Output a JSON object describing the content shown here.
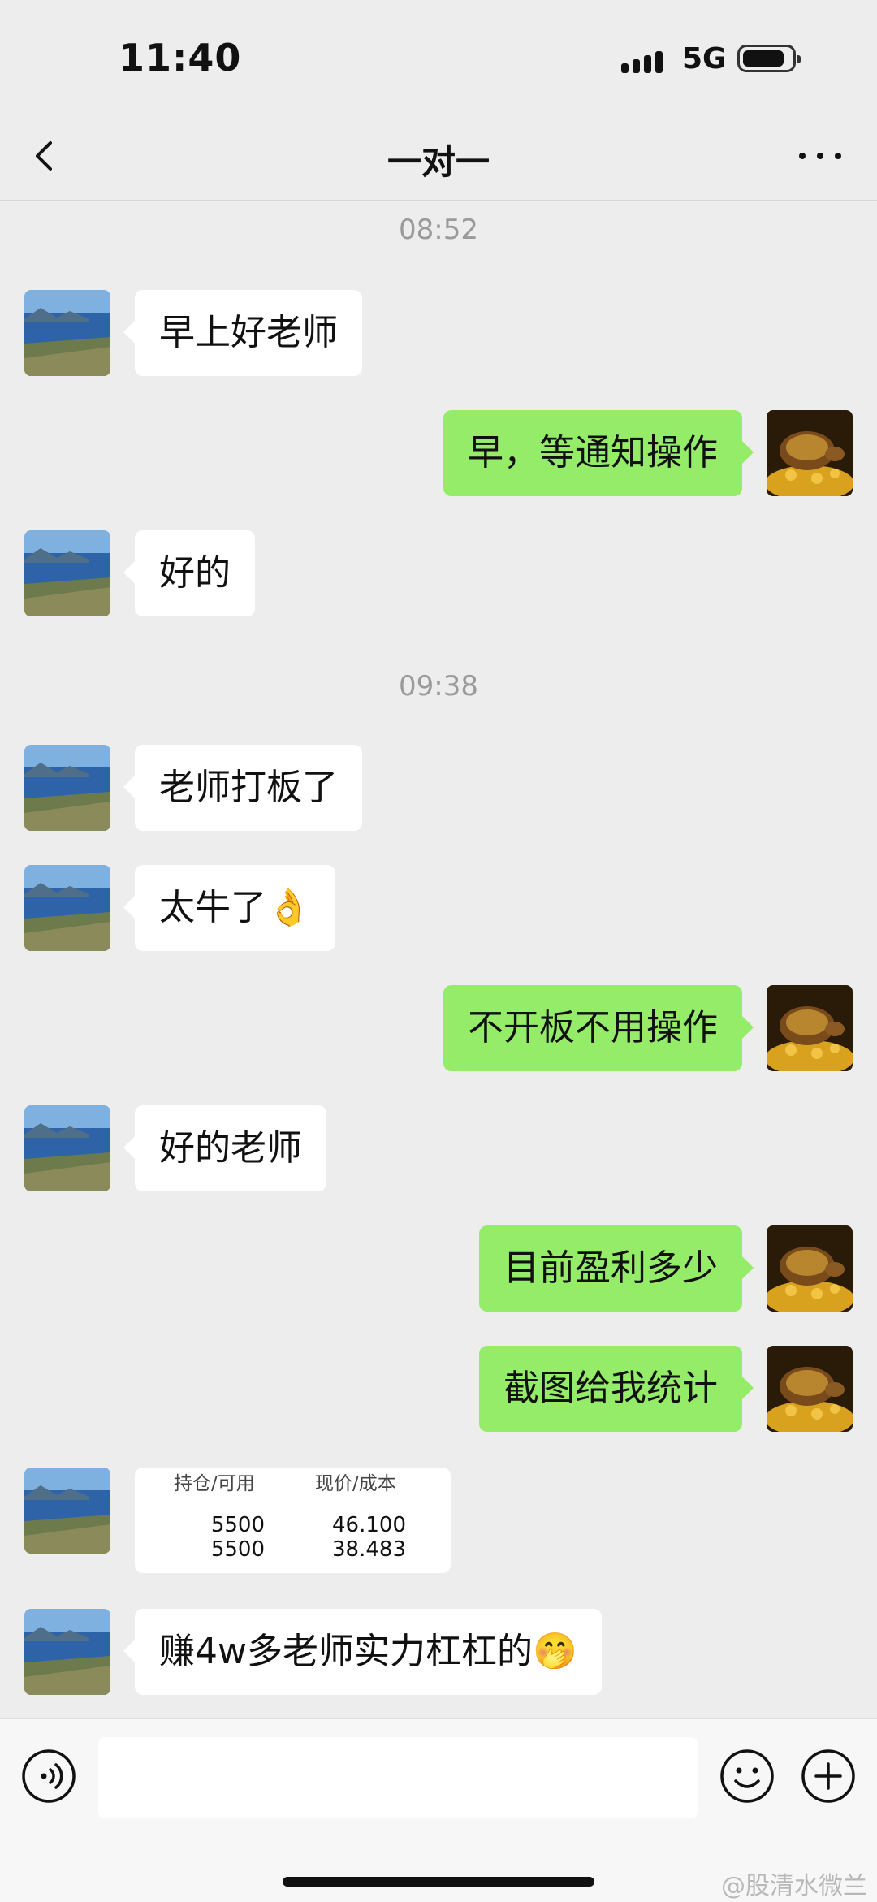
{
  "status_bar": {
    "time": "11:40",
    "network": "5G"
  },
  "nav": {
    "title": "一对一"
  },
  "messages": [
    {
      "type": "time",
      "text": "08:52"
    },
    {
      "type": "in",
      "text": "早上好老师"
    },
    {
      "type": "out",
      "text": "早，等通知操作"
    },
    {
      "type": "in",
      "text": "好的"
    },
    {
      "type": "time",
      "text": "09:38"
    },
    {
      "type": "in",
      "text": "老师打板了"
    },
    {
      "type": "in",
      "text": "太牛了👌"
    },
    {
      "type": "out",
      "text": "不开板不用操作"
    },
    {
      "type": "in",
      "text": "好的老师"
    },
    {
      "type": "out",
      "text": "目前盈利多少"
    },
    {
      "type": "out",
      "text": "截图给我统计"
    },
    {
      "type": "in_image",
      "headers": [
        "持仓/可用",
        "现价/成本"
      ],
      "rows": [
        [
          "5500",
          "46.100"
        ],
        [
          "5500",
          "38.483"
        ]
      ]
    },
    {
      "type": "in",
      "text": "赚4w多老师实力杠杠的🤭"
    }
  ],
  "watermark": "@股清水微兰",
  "colors": {
    "background": "#ededed",
    "bubble_out": "#95ec69",
    "bubble_in": "#ffffff"
  },
  "icons": [
    "back-chevron-icon",
    "more-dots-icon",
    "voice-icon",
    "emoji-icon",
    "plus-icon"
  ]
}
